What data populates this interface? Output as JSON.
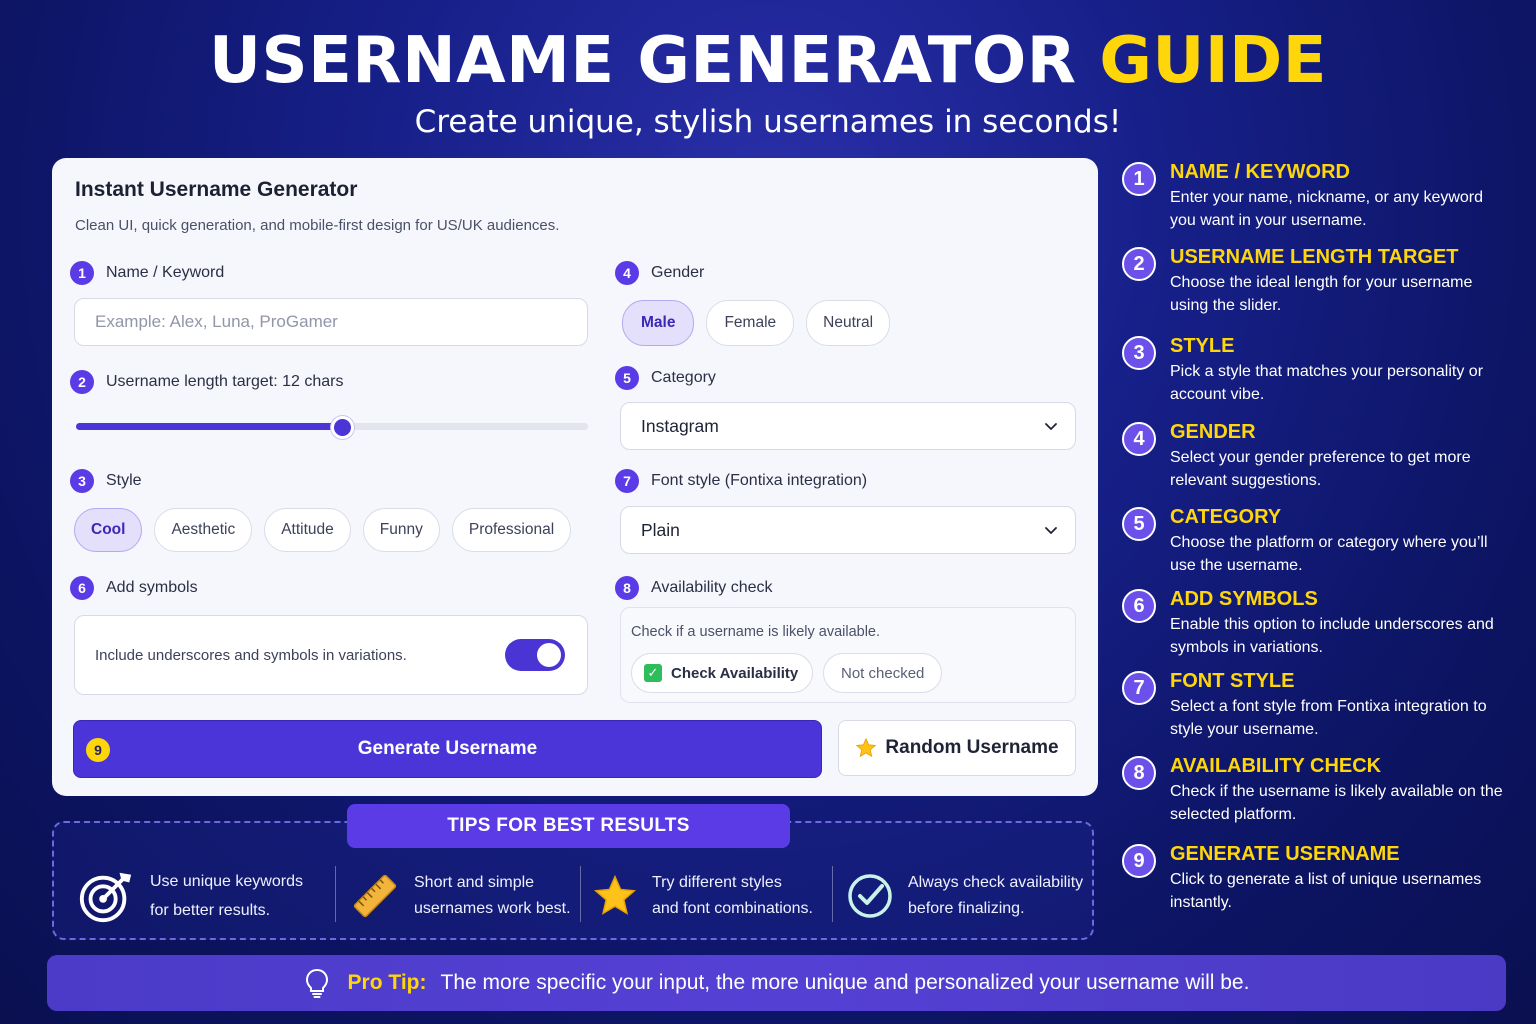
{
  "header": {
    "title_main": "USERNAME GENERATOR",
    "title_highlight": "GUIDE",
    "subtitle": "Create unique, stylish usernames in seconds!"
  },
  "card": {
    "title": "Instant Username Generator",
    "description": "Clean UI, quick generation, and mobile-first design for US/UK audiences.",
    "name_field": {
      "num": "1",
      "label": "Name / Keyword",
      "placeholder": "Example: Alex, Luna, ProGamer"
    },
    "length_field": {
      "num": "2",
      "label": "Username length target: 12 chars",
      "slider_fraction": 0.52
    },
    "style_field": {
      "num": "3",
      "label": "Style",
      "options": [
        "Cool",
        "Aesthetic",
        "Attitude",
        "Funny",
        "Professional"
      ],
      "selected": "Cool"
    },
    "gender_field": {
      "num": "4",
      "label": "Gender",
      "options": [
        "Male",
        "Female",
        "Neutral"
      ],
      "selected": "Male"
    },
    "category_field": {
      "num": "5",
      "label": "Category",
      "value": "Instagram"
    },
    "symbols_field": {
      "num": "6",
      "label": "Add symbols",
      "text": "Include underscores and symbols in variations.",
      "enabled": true
    },
    "font_field": {
      "num": "7",
      "label": "Font style (Fontixa integration)",
      "value": "Plain"
    },
    "availability_field": {
      "num": "8",
      "label": "Availability check",
      "text": "Check if a username is likely available.",
      "button": "Check Availability",
      "status": "Not checked"
    },
    "generate_button": {
      "num": "9",
      "label": "Generate Username"
    },
    "random_button": {
      "label": "Random Username"
    }
  },
  "tips": {
    "header": "TIPS FOR BEST RESULTS",
    "items": [
      {
        "line1": "Use unique keywords",
        "line2": "for better results.",
        "icon": "target-icon"
      },
      {
        "line1": "Short and simple",
        "line2": "usernames work best.",
        "icon": "ruler-icon"
      },
      {
        "line1": "Try different styles",
        "line2": "and font combinations.",
        "icon": "star-icon"
      },
      {
        "line1": "Always check availability",
        "line2": "before finalizing.",
        "icon": "check-circle-icon"
      }
    ]
  },
  "protip": {
    "label": "Pro Tip:",
    "text": "The more specific your input, the more unique and personalized your username will be."
  },
  "steps": [
    {
      "num": "1",
      "title": "NAME / KEYWORD",
      "desc": "Enter your name, nickname, or any keyword you want in your username."
    },
    {
      "num": "2",
      "title": "USERNAME LENGTH TARGET",
      "desc": "Choose the ideal length for your username using the slider."
    },
    {
      "num": "3",
      "title": "STYLE",
      "desc": "Pick a style that matches your personality or account vibe."
    },
    {
      "num": "4",
      "title": "GENDER",
      "desc": "Select your gender preference to get more relevant suggestions."
    },
    {
      "num": "5",
      "title": "CATEGORY",
      "desc": "Choose the platform or category where you’ll use the username."
    },
    {
      "num": "6",
      "title": "ADD SYMBOLS",
      "desc": "Enable this option to include underscores and symbols in variations."
    },
    {
      "num": "7",
      "title": "FONT STYLE",
      "desc": "Select a font style from Fontixa integration to style your username."
    },
    {
      "num": "8",
      "title": "AVAILABILITY CHECK",
      "desc": "Check if the username is likely available on the selected platform."
    },
    {
      "num": "9",
      "title": "GENERATE USERNAME",
      "desc": "Click to generate a list of unique usernames instantly."
    }
  ],
  "colors": {
    "accent": "#4b34d8",
    "highlight": "#ffd60a",
    "background": "#17208a"
  }
}
